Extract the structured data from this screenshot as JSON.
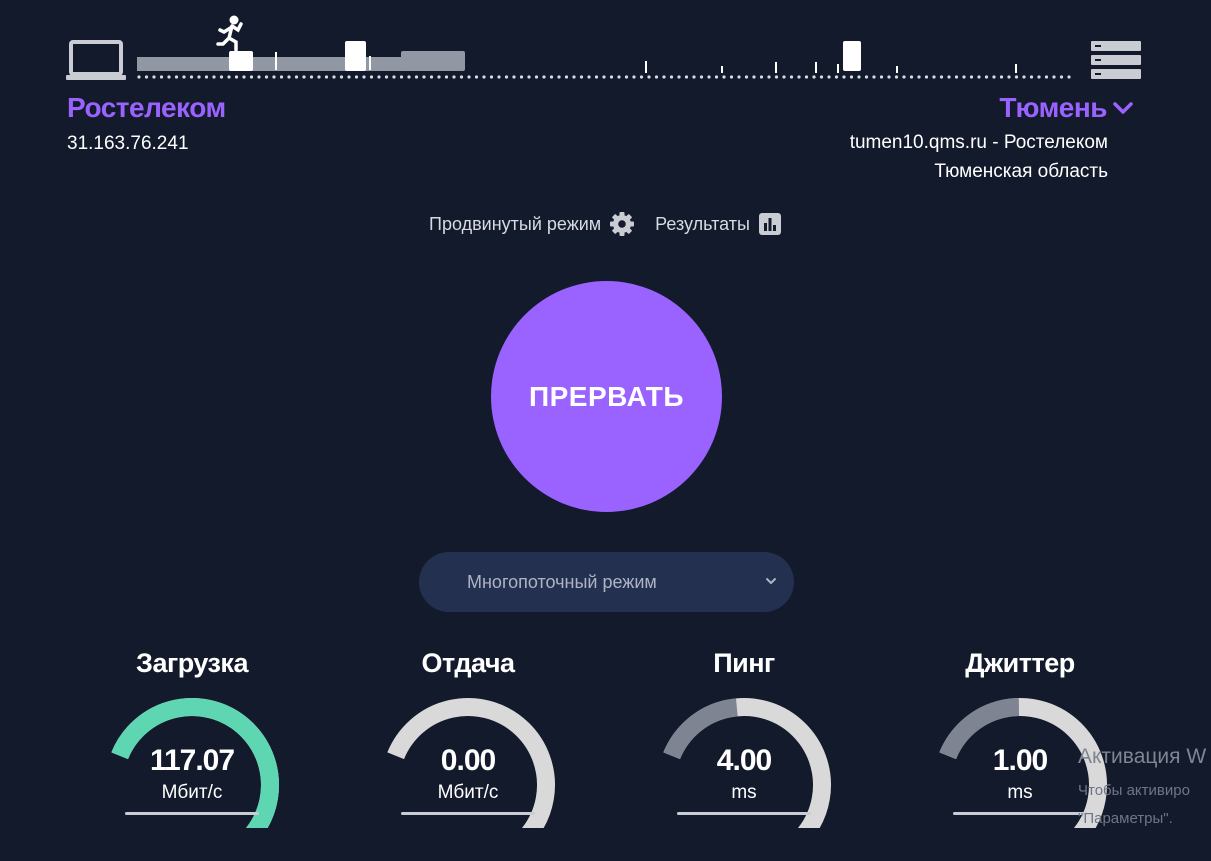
{
  "client": {
    "provider": "Ростелеком",
    "ip": "31.163.76.241"
  },
  "server_info": {
    "city": "Тюмень",
    "host": "tumen10.qms.ru - Ростелеком",
    "region": "Тюменская область"
  },
  "links": {
    "advanced": "Продвинутый режим",
    "results": "Результаты"
  },
  "main_button": {
    "label": "ПРЕРВАТЬ"
  },
  "mode_select": {
    "value": "Многопоточный режим"
  },
  "metrics": [
    {
      "title": "Загрузка",
      "value": "117.07",
      "unit": "Мбит/с",
      "fill": 0.92,
      "color": "#5fd6b2"
    },
    {
      "title": "Отдача",
      "value": "0.00",
      "unit": "Мбит/с",
      "fill": 0.0,
      "color": "#5fd6b2"
    },
    {
      "title": "Пинг",
      "value": "4.00",
      "unit": "ms",
      "fill": 0.28,
      "color": "#7e8491"
    },
    {
      "title": "Джиттер",
      "value": "1.00",
      "unit": "ms",
      "fill": 0.3,
      "color": "#7e8491"
    }
  ],
  "watermark": {
    "title": "Активация W",
    "line1": "Чтобы активиро",
    "line2": "\"Параметры\"."
  },
  "colors": {
    "accent": "#9a62ff",
    "background": "#131a2b",
    "select_bg": "#23304f",
    "download": "#5fd6b2",
    "track": "#d9d9d9"
  },
  "icons": [
    "laptop-icon",
    "runner-icon",
    "server-icon",
    "chevron-down-icon",
    "gear-icon",
    "bar-chart-icon"
  ]
}
